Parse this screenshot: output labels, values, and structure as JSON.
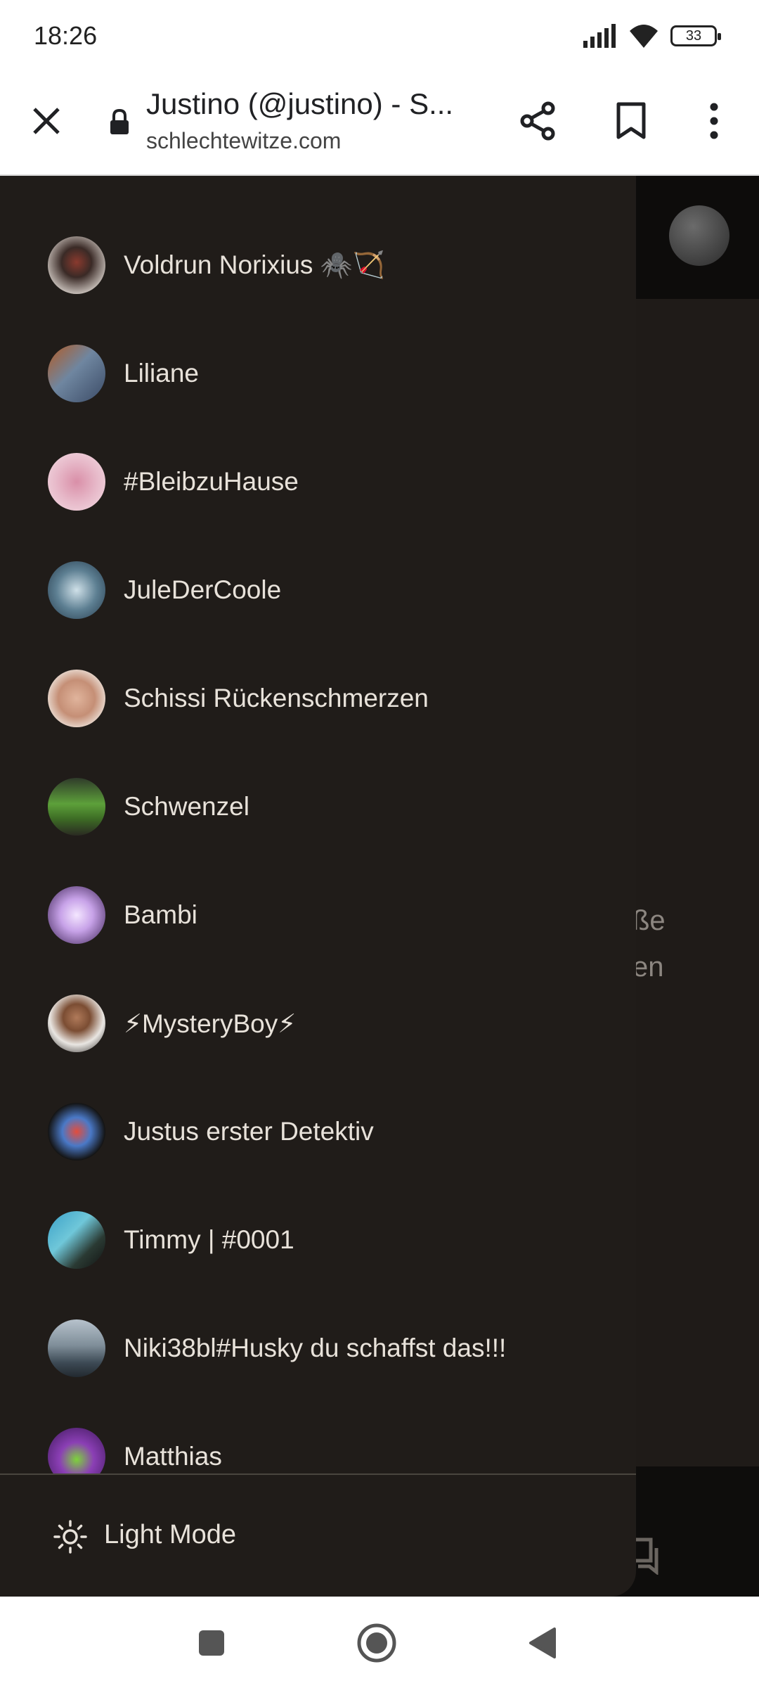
{
  "status_bar": {
    "time": "18:26",
    "battery": "33"
  },
  "browser": {
    "title": "Justino (@justino) - S...",
    "url": "schlechtewitze.com"
  },
  "background_page": {
    "text_fragments": [
      "ße",
      "en"
    ]
  },
  "drawer": {
    "items": [
      {
        "label": "Voldrun Norixius 🕷️🏹",
        "avatar": "dark-warrior"
      },
      {
        "label": "Liliane",
        "avatar": "autumn"
      },
      {
        "label": "#BleibzuHause",
        "avatar": "pink-cartoon"
      },
      {
        "label": "JuleDerCoole",
        "avatar": "owl"
      },
      {
        "label": "Schissi Rückenschmerzen",
        "avatar": "old-man"
      },
      {
        "label": "Schwenzel",
        "avatar": "stadium"
      },
      {
        "label": "Bambi",
        "avatar": "glowing-creature"
      },
      {
        "label": "⚡MysteryBoy⚡",
        "avatar": "man-in-shirt"
      },
      {
        "label": "Justus erster Detektiv",
        "avatar": "cartoon-kids"
      },
      {
        "label": "Timmy | #0001",
        "avatar": "beach-selfie"
      },
      {
        "label": "Niki38bl#Husky du schaffst das!!!",
        "avatar": "lake-mountain"
      },
      {
        "label": "Matthias",
        "avatar": "purple-tentacle"
      }
    ],
    "light_mode_label": "Light Mode"
  },
  "colors": {
    "drawer_bg": "#201c19",
    "drawer_text": "#e8e2da",
    "page_bg": "#1f1b18"
  }
}
